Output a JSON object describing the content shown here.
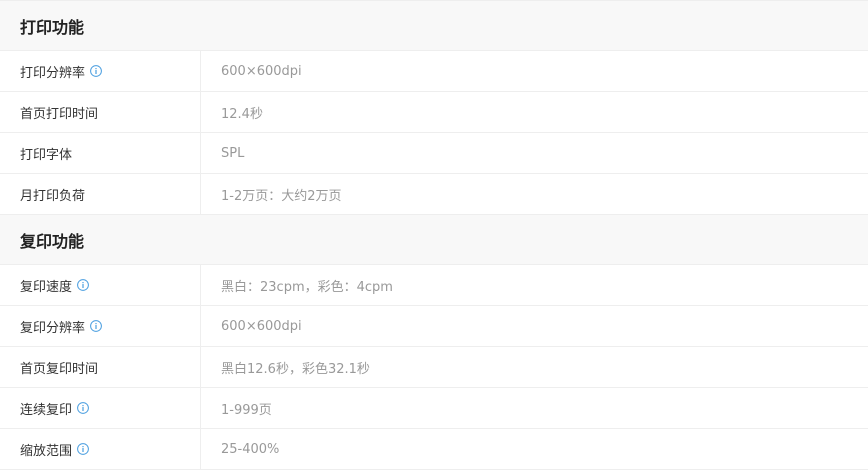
{
  "sections": [
    {
      "title": "打印功能",
      "rows": [
        {
          "label": "打印分辨率",
          "value": "600×600dpi",
          "info": true
        },
        {
          "label": "首页打印时间",
          "value": "12.4秒",
          "info": false
        },
        {
          "label": "打印字体",
          "value": "SPL",
          "info": false
        },
        {
          "label": "月打印负荷",
          "value": "1-2万页：大约2万页",
          "info": false
        }
      ]
    },
    {
      "title": "复印功能",
      "rows": [
        {
          "label": "复印速度",
          "value": "黑白：23cpm，彩色：4cpm",
          "info": true
        },
        {
          "label": "复印分辨率",
          "value": "600×600dpi",
          "info": true
        },
        {
          "label": "首页复印时间",
          "value": "黑白12.6秒，彩色32.1秒",
          "info": false
        },
        {
          "label": "连续复印",
          "value": "1-999页",
          "info": true
        },
        {
          "label": "缩放范围",
          "value": "25-400%",
          "info": true
        }
      ]
    }
  ],
  "colors": {
    "info_icon": "#4a9ee0",
    "section_bg": "#f8f8f8",
    "border": "#eeeeee"
  },
  "icons": {
    "info": "info-icon"
  }
}
